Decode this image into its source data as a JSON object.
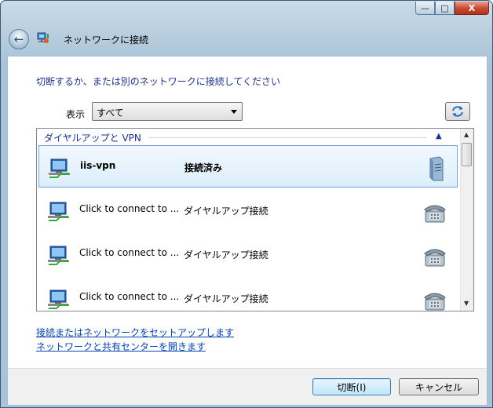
{
  "window": {
    "title": "ネットワークに接続",
    "caption": {
      "minimize": "—",
      "maximize": "□",
      "close": "X"
    }
  },
  "instruction": "切断するか、または別のネットワークに接続してください",
  "filter": {
    "label": "表示",
    "selected": "すべて"
  },
  "group": {
    "title": "ダイヤルアップと VPN"
  },
  "connections": [
    {
      "name": "iis-vpn",
      "status": "接続済み",
      "device": "server-icon"
    },
    {
      "name": "Click to connect to ...",
      "status": "ダイヤルアップ接続",
      "device": "phone-icon"
    },
    {
      "name": "Click to connect to ...",
      "status": "ダイヤルアップ接続",
      "device": "phone-icon"
    },
    {
      "name": "Click to connect to ...",
      "status": "ダイヤルアップ接続",
      "device": "phone-icon"
    }
  ],
  "links": {
    "setup": "接続またはネットワークをセットアップします",
    "center": "ネットワークと共有センターを開きます"
  },
  "buttons": {
    "disconnect": "切断(I)",
    "cancel": "キャンセル"
  },
  "colors": {
    "accent": "#1e3287",
    "link": "#0645ad",
    "selected_row": "#dceefb"
  }
}
